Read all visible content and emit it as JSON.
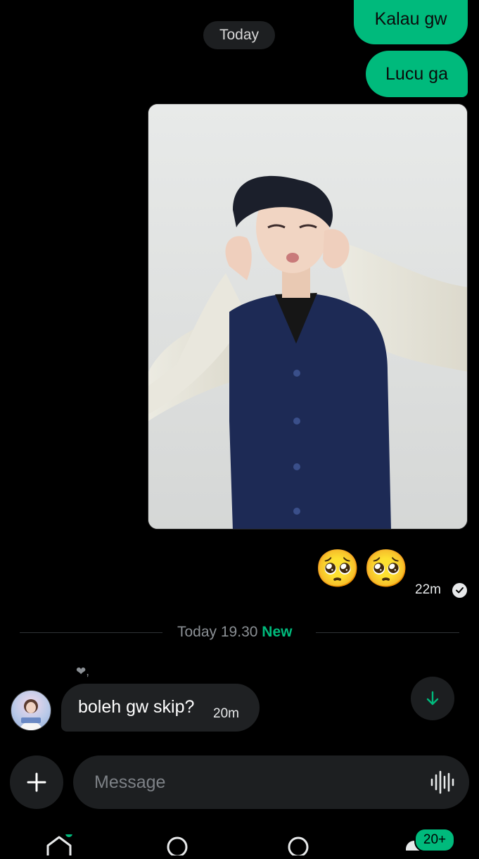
{
  "messages": {
    "date_separator": "Today",
    "sent": [
      {
        "text": "Kalau gw"
      },
      {
        "text": "Lucu ga"
      }
    ],
    "photo_alt": "Photo",
    "emoji_reply": [
      "🥺",
      "🥺"
    ],
    "sent_time": "22m",
    "new_divider": {
      "time": "Today 19.30",
      "label": "New"
    },
    "reaction": "❤,",
    "received": {
      "text": "boleh gw skip?",
      "time": "20m"
    }
  },
  "composer": {
    "placeholder": "Message"
  },
  "nav": {
    "badge": "20+"
  },
  "colors": {
    "accent": "#00ba7c",
    "background": "#000000",
    "bubble_received": "#1f2123"
  },
  "icons": [
    "check-circle-icon",
    "arrow-down-icon",
    "plus-icon",
    "voice-waveform-icon",
    "home-icon",
    "search-icon",
    "notifications-icon"
  ]
}
